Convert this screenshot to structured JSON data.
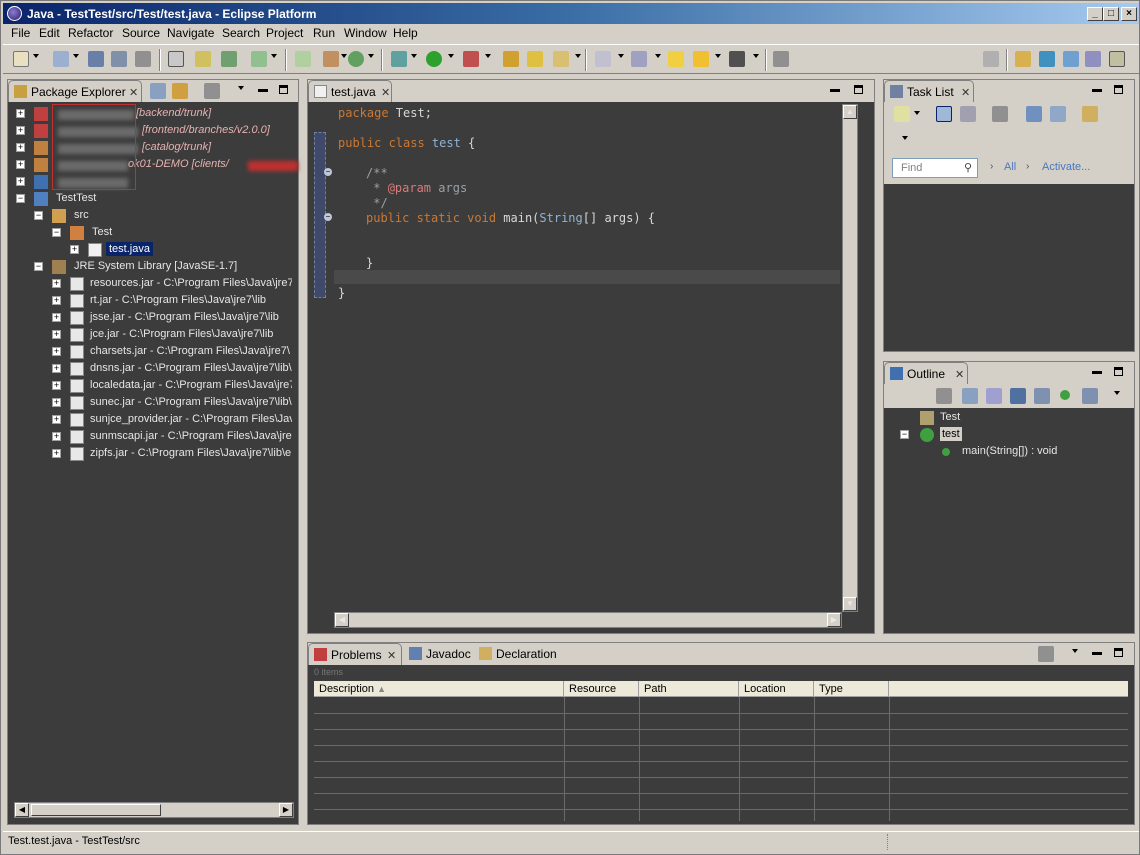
{
  "window": {
    "title": "Java - TestTest/src/Test/test.java - Eclipse Platform"
  },
  "menu": [
    "File",
    "Edit",
    "Refactor",
    "Source",
    "Navigate",
    "Search",
    "Project",
    "Run",
    "Window",
    "Help"
  ],
  "package_explorer": {
    "tab": "Package Explorer",
    "items": [
      {
        "label": "[backend/trunk]",
        "blurred": true
      },
      {
        "label": "[frontend/branches/v2.0.0]",
        "blurred": true
      },
      {
        "label": "[catalog/trunk]",
        "blurred": true
      },
      {
        "label": "ok01-DEMO [clients/",
        "blurred": true
      },
      {
        "label": "",
        "blurred": true
      }
    ],
    "project": "TestTest",
    "src": "src",
    "package": "Test",
    "file": "test.java",
    "jre": "JRE System Library [JavaSE-1.7]",
    "jars": [
      "resources.jar - C:\\Program Files\\Java\\jre7",
      "rt.jar - C:\\Program Files\\Java\\jre7\\lib",
      "jsse.jar - C:\\Program Files\\Java\\jre7\\lib",
      "jce.jar - C:\\Program Files\\Java\\jre7\\lib",
      "charsets.jar - C:\\Program Files\\Java\\jre7\\",
      "dnsns.jar - C:\\Program Files\\Java\\jre7\\lib\\",
      "localedata.jar - C:\\Program Files\\Java\\jre7",
      "sunec.jar - C:\\Program Files\\Java\\jre7\\lib\\",
      "sunjce_provider.jar - C:\\Program Files\\Jav",
      "sunmscapi.jar - C:\\Program Files\\Java\\jre",
      "zipfs.jar - C:\\Program Files\\Java\\jre7\\lib\\e"
    ]
  },
  "editor": {
    "tab": "test.java",
    "lines": {
      "l1a": "package",
      "l1b": " Test;",
      "l2a": "public class",
      "l2b": " test",
      "l2c": " {",
      "l3": "/**",
      "l4a": " * ",
      "l4b": "@param",
      "l4c": " args",
      "l5": " */",
      "l6a": "public static void",
      "l6b": " main(",
      "l6c": "String",
      "l6d": "[] args) {",
      "l7": "}",
      "l8": "}"
    }
  },
  "task_list": {
    "tab": "Task List",
    "find_placeholder": "Find",
    "all": "All",
    "activate": "Activate..."
  },
  "outline": {
    "tab": "Outline",
    "package": "Test",
    "class": "test",
    "method": "main(String[]) : void"
  },
  "bottom": {
    "tabs": [
      "Problems",
      "Javadoc",
      "Declaration"
    ],
    "summary": "0 items",
    "columns": [
      "Description",
      "Resource",
      "Path",
      "Location",
      "Type"
    ]
  },
  "status": {
    "text": "Test.test.java - TestTest/src"
  }
}
